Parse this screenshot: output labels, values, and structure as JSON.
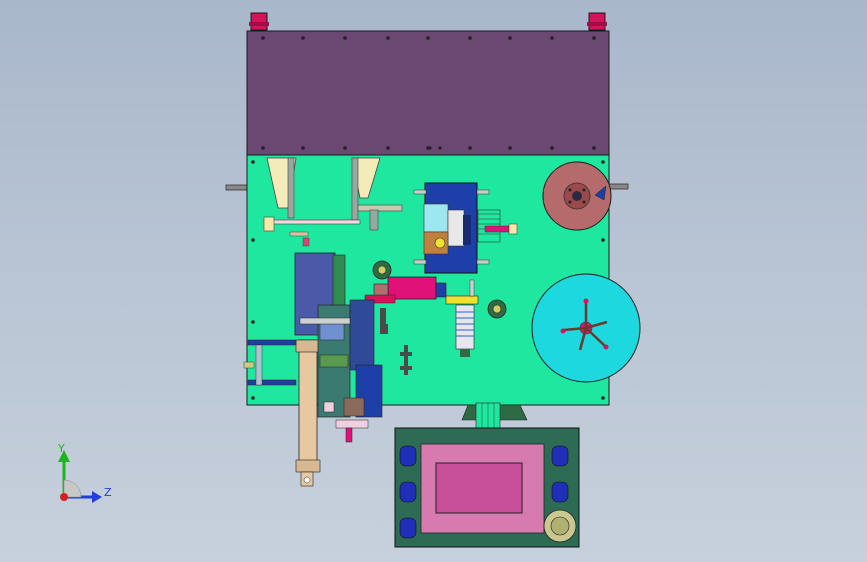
{
  "viewport": {
    "background_top": "#a9b7cb",
    "background_bottom": "#c7d0dc"
  },
  "model": {
    "colors": {
      "top_plate": "#6b4872",
      "base_plate": "#1ee8a0",
      "outline": "#1a1a1a",
      "disc": "#b56b6b",
      "round_table": "#1ed8e0",
      "control_box": "#2e6b55",
      "screen_frame": "#d67ab0",
      "screen": "#c8509a",
      "blue_part": "#1f3fa8",
      "magenta_part": "#e0127a",
      "yellow_part": "#f0e030",
      "cyan_part": "#9de8f0",
      "knob": "#d4145a"
    }
  },
  "triad": {
    "y_label": "Y",
    "z_label": "Z",
    "y_color": "#1fb31f",
    "z_color": "#1f3fd8",
    "origin_color": "#d81f1f"
  }
}
